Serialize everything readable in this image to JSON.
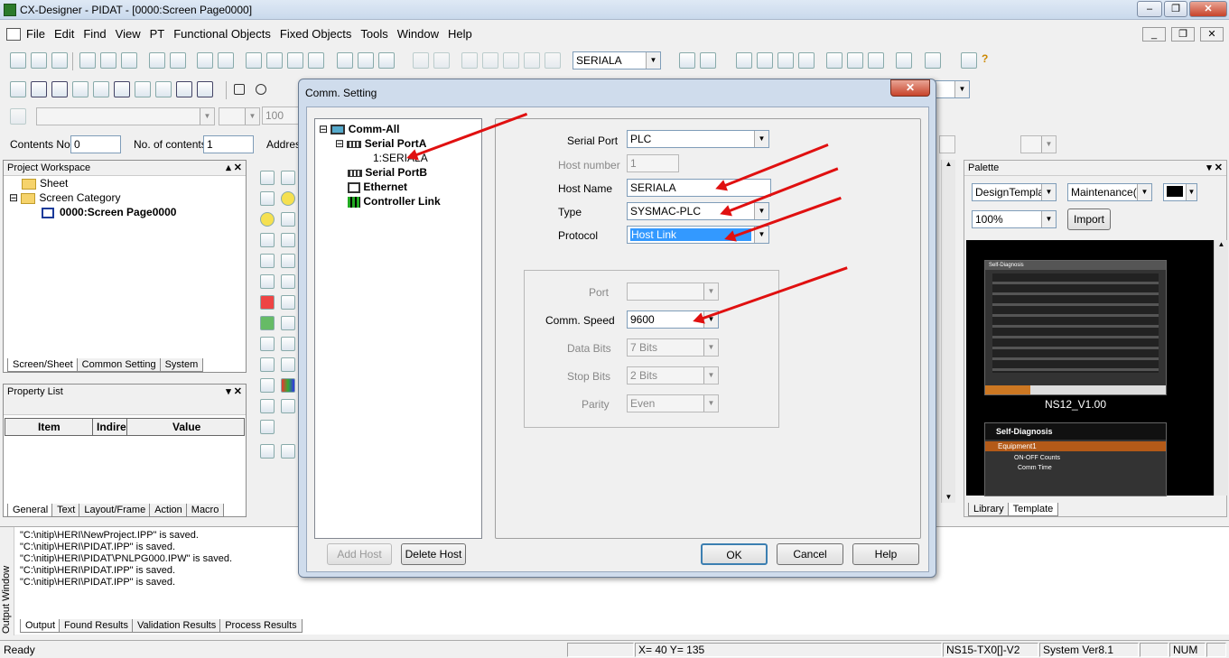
{
  "window": {
    "title": "CX-Designer - PIDAT - [0000:Screen Page0000]"
  },
  "menu": [
    "File",
    "Edit",
    "Find",
    "View",
    "PT",
    "Functional Objects",
    "Fixed Objects",
    "Tools",
    "Window",
    "Help"
  ],
  "toolbar": {
    "port_combo": "SERIALA",
    "zoom": "100"
  },
  "contents": {
    "no_label": "Contents No.",
    "no_value": "0",
    "count_label": "No. of contents",
    "count_value": "1",
    "address_label": "Address"
  },
  "project": {
    "title": "Project Workspace",
    "items": [
      "Sheet",
      "Screen Category",
      "0000:Screen Page0000"
    ],
    "tabs": [
      "Screen/Sheet",
      "Common Setting",
      "System"
    ]
  },
  "property": {
    "title": "Property List",
    "columns": [
      "Item",
      "Indire",
      "Value"
    ],
    "tabs": [
      "General",
      "Text",
      "Layout/Frame",
      "Action",
      "Macro"
    ]
  },
  "palette": {
    "title": "Palette",
    "category": "DesignTemplate",
    "subcategory": "Maintenance(C",
    "zoom": "100%",
    "import_label": "Import",
    "thumb1_title": "Self-Diagnosis",
    "thumb1_caption": "NS12_V1.00",
    "thumb2_title": "Self-Diagnosis",
    "thumb2_sub": "Equipment1",
    "thumb2_rows": [
      "ON-OFF Counts",
      "Comm Time"
    ],
    "tabs": [
      "Library",
      "Template"
    ]
  },
  "output": {
    "side_label": "Output Window",
    "lines": [
      "\"C:\\nitip\\HERI\\NewProject.IPP\" is saved.",
      "\"C:\\nitip\\HERI\\PIDAT.IPP\" is saved.",
      "\"C:\\nitip\\HERI\\PIDAT\\PNLPG000.IPW\" is saved.",
      "\"C:\\nitip\\HERI\\PIDAT.IPP\" is saved.",
      "\"C:\\nitip\\HERI\\PIDAT.IPP\" is saved."
    ],
    "tabs": [
      "Output",
      "Found Results",
      "Validation Results",
      "Process Results"
    ]
  },
  "dialog": {
    "title": "Comm. Setting",
    "tree": [
      "Comm-All",
      "Serial PortA",
      "1:SERIALA",
      "Serial PortB",
      "Ethernet",
      "Controller Link"
    ],
    "serial_port_label": "Serial Port",
    "serial_port": "PLC",
    "host_number_label": "Host number",
    "host_number": "1",
    "host_name_label": "Host Name",
    "host_name": "SERIALA",
    "type_label": "Type",
    "type": "SYSMAC-PLC",
    "protocol_label": "Protocol",
    "protocol": "Host Link",
    "port_label": "Port",
    "port": "",
    "speed_label": "Comm. Speed",
    "speed": "9600",
    "databits_label": "Data Bits",
    "databits": "7 Bits",
    "stopbits_label": "Stop Bits",
    "stopbits": "2 Bits",
    "parity_label": "Parity",
    "parity": "Even",
    "add_host": "Add Host",
    "delete_host": "Delete Host",
    "ok": "OK",
    "cancel": "Cancel",
    "help": "Help"
  },
  "status": {
    "ready": "Ready",
    "coords": "X=  40 Y= 135",
    "pt_model": "NS15-TX0[]-V2",
    "system": "System Ver8.1",
    "num": "NUM"
  },
  "colors": {
    "accent_red": "#e01010",
    "selection": "#3399ff"
  }
}
